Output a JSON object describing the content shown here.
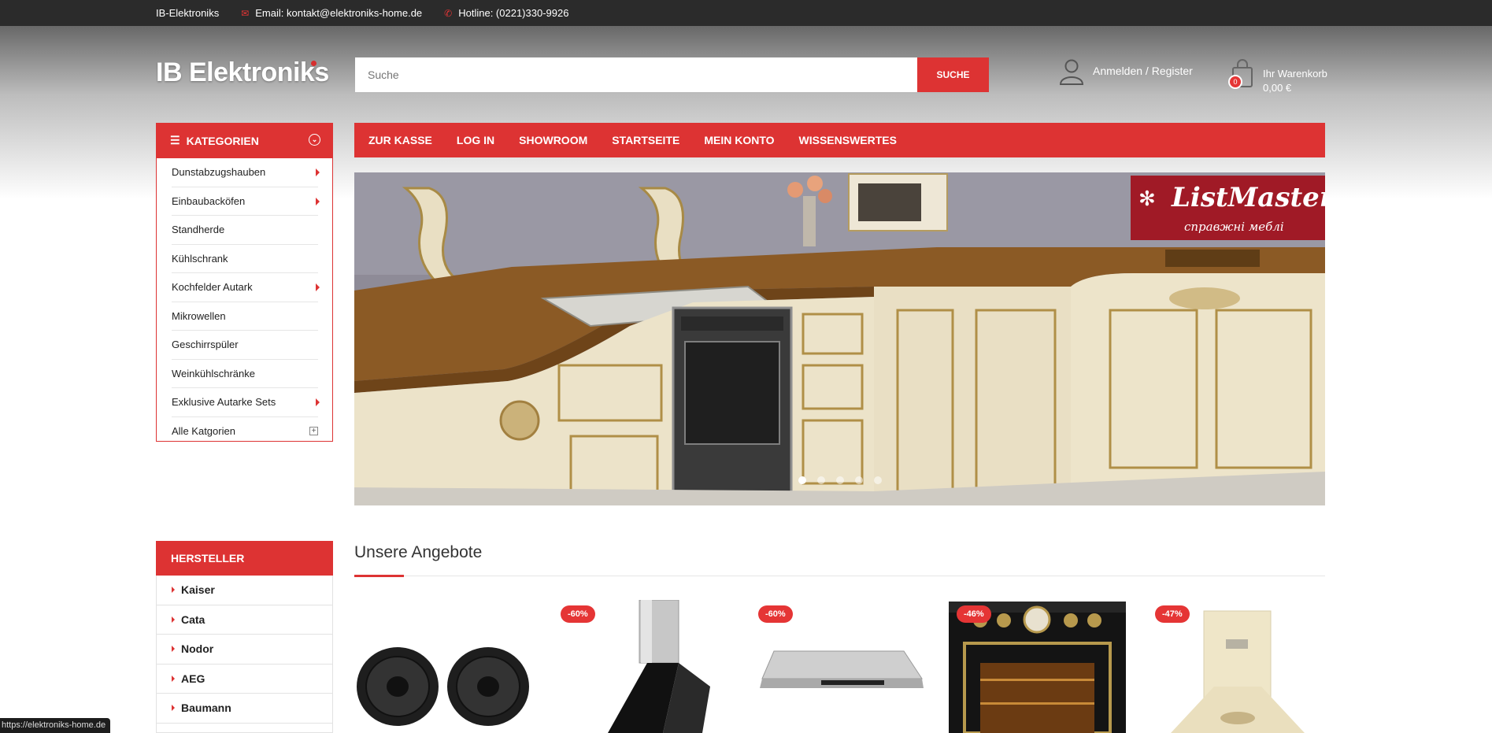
{
  "topbar": {
    "shop_name": "IB-Elektroniks",
    "email": "Email: kontakt@elektroniks-home.de",
    "hotline": "Hotline: (0221)330-9926"
  },
  "header": {
    "logo": "IB Elektroniks",
    "search_placeholder": "Suche",
    "search_button": "SUCHE",
    "account_label": "Anmelden / Register",
    "cart_label": "Ihr Warenkorb",
    "cart_total": "0,00 €",
    "cart_count": "0"
  },
  "categories": {
    "title": "KATEGORIEN",
    "items": [
      {
        "label": "Dunstabzugshauben",
        "has_sub": true
      },
      {
        "label": "Einbaubacköfen",
        "has_sub": true
      },
      {
        "label": "Standherde",
        "has_sub": false
      },
      {
        "label": "Kühlschrank",
        "has_sub": false
      },
      {
        "label": "Kochfelder Autark",
        "has_sub": true
      },
      {
        "label": "Mikrowellen",
        "has_sub": false
      },
      {
        "label": "Geschirrspüler",
        "has_sub": false
      },
      {
        "label": "Weinkühlschränke",
        "has_sub": false
      },
      {
        "label": "Exklusive Autarke Sets",
        "has_sub": true
      }
    ],
    "all_label": "Alle Katgorien"
  },
  "nav": {
    "items": [
      "ZUR KASSE",
      "LOG IN",
      "SHOWROOM",
      "STARTSEITE",
      "MEIN KONTO",
      "WISSENSWERTES"
    ]
  },
  "slider": {
    "brand_main": "ListMaster",
    "brand_sub": "справжні меблі",
    "slide_count": 5,
    "active_slide": 1
  },
  "hersteller": {
    "title": "HERSTELLER",
    "items": [
      "Kaiser",
      "Cata",
      "Nodor",
      "AEG",
      "Baumann"
    ]
  },
  "offers": {
    "title": "Unsere Angebote",
    "products": [
      {
        "name": "carbon-filter",
        "discount": ""
      },
      {
        "name": "wall-hood-black",
        "discount": "-60%"
      },
      {
        "name": "telescopic-hood",
        "discount": "-60%"
      },
      {
        "name": "retro-oven-black",
        "discount": "-46%"
      },
      {
        "name": "retro-hood-cream",
        "discount": "-47%"
      }
    ]
  },
  "statusbar": {
    "url": "https://elektroniks-home.de"
  },
  "colors": {
    "accent": "#dd3333",
    "topbar": "#2b2b2b"
  }
}
